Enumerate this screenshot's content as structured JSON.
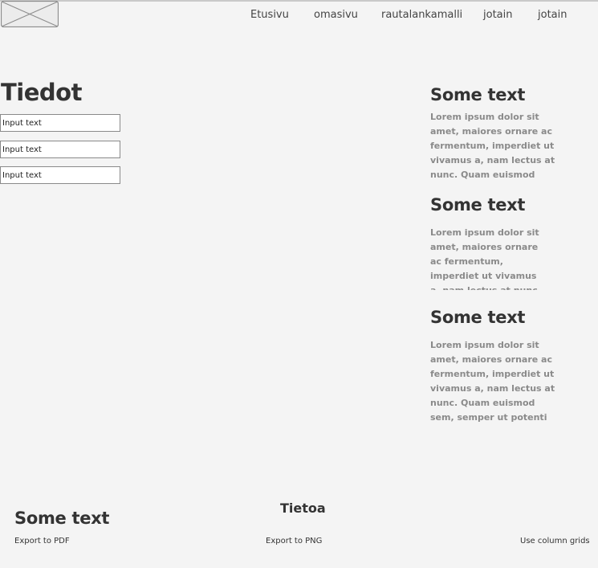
{
  "header": {
    "logo_icon": "image-placeholder-icon",
    "nav": [
      {
        "label": "Etusivu"
      },
      {
        "label": "omasivu"
      },
      {
        "label": "rautalankamalli"
      },
      {
        "label": "jotain"
      },
      {
        "label": "jotain"
      }
    ]
  },
  "main": {
    "title": "Tiedot",
    "inputs": [
      {
        "placeholder": "Input text"
      },
      {
        "placeholder": "Input text"
      },
      {
        "placeholder": "Input text"
      }
    ]
  },
  "sidebar": {
    "blocks": [
      {
        "heading": "Some text",
        "body": "Lorem ipsum dolor sit amet, maiores ornare ac fermentum, imperdiet ut vivamus a, nam lectus at nunc. Quam euismod sem,"
      },
      {
        "heading": "Some text",
        "body": "Lorem ipsum dolor sit amet, maiores ornare ac fermentum, imperdiet ut vivamus a, nam lectus at nunc. Quam euismod sem,"
      },
      {
        "heading": "Some text",
        "body": "Lorem ipsum dolor sit amet, maiores ornare ac fermentum, imperdiet ut vivamus a, nam lectus at nunc. Quam euismod sem, semper ut potenti"
      }
    ]
  },
  "footer": {
    "heading": "Some text",
    "center_title": "Tietoa",
    "export_pdf": "Export to PDF",
    "export_png": "Export to PNG",
    "column_grids": "Use column grids"
  },
  "colors": {
    "background": "#f4f4f4",
    "text_dark": "#333333",
    "text_muted": "#8a8a8a",
    "border": "#8a8a8a"
  }
}
